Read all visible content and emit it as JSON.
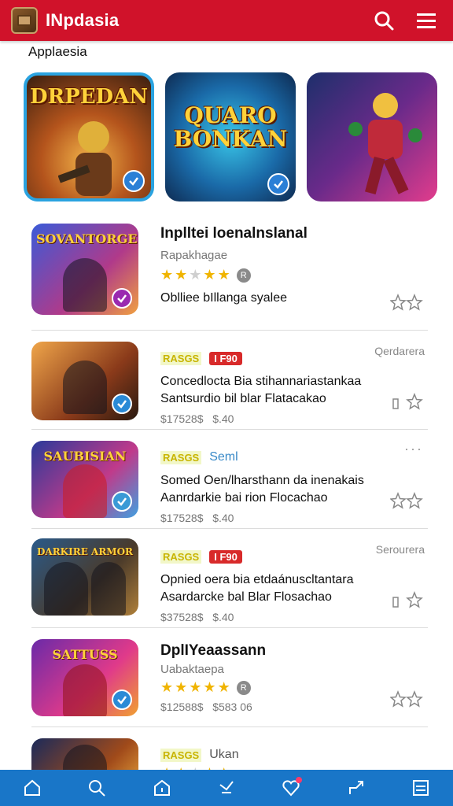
{
  "header": {
    "title": "INpdasia"
  },
  "section": {
    "label": "Applaesia"
  },
  "featured": [
    {
      "title": "DRPEDAN"
    },
    {
      "title": "QUARO BONKAN"
    },
    {
      "title": ""
    }
  ],
  "apps": [
    {
      "thumb_title": "SOVANTORGE",
      "name": "Inplltei loenalnslanal",
      "subtitle": "Rapakhagae",
      "rating": 2,
      "description": "Oblliee bIllanga syalee"
    },
    {
      "thumb_title": "",
      "tag1": "RASGS",
      "tag2": "I F90",
      "side": "Qerdarera",
      "description": "Concedlocta Bia stihannariastankaa Santsurdio bil blar Flatacakao",
      "price": "$17528$",
      "price2": "$.40"
    },
    {
      "thumb_title": "SAUBISIAN",
      "tag1": "RASGS",
      "tag2_blue": "Seml",
      "side": "···",
      "description": "Somed Oen/lharsthann da inenakais Aanrdarkie bai rion Flocachao",
      "price": "$17528$",
      "price2": "$.40"
    },
    {
      "thumb_title": "DARKIRE ARMOR",
      "tag1": "RASGS",
      "tag2": "I F90",
      "side": "Serourera",
      "description": "Opnied oera bia etdaánuscltantara Asardarcke bal Blar Flosachao",
      "price": "$37528$",
      "price2": "$.40"
    },
    {
      "thumb_title": "SATTUSS",
      "name": "DplIYeaassann",
      "subtitle": "Uabaktaepa",
      "rating": 5,
      "price": "$12588$",
      "price2": "$583 06"
    },
    {
      "thumb_title": "",
      "tag1": "RASGS",
      "tag2_blue": "Ukan",
      "rating": 2
    }
  ]
}
